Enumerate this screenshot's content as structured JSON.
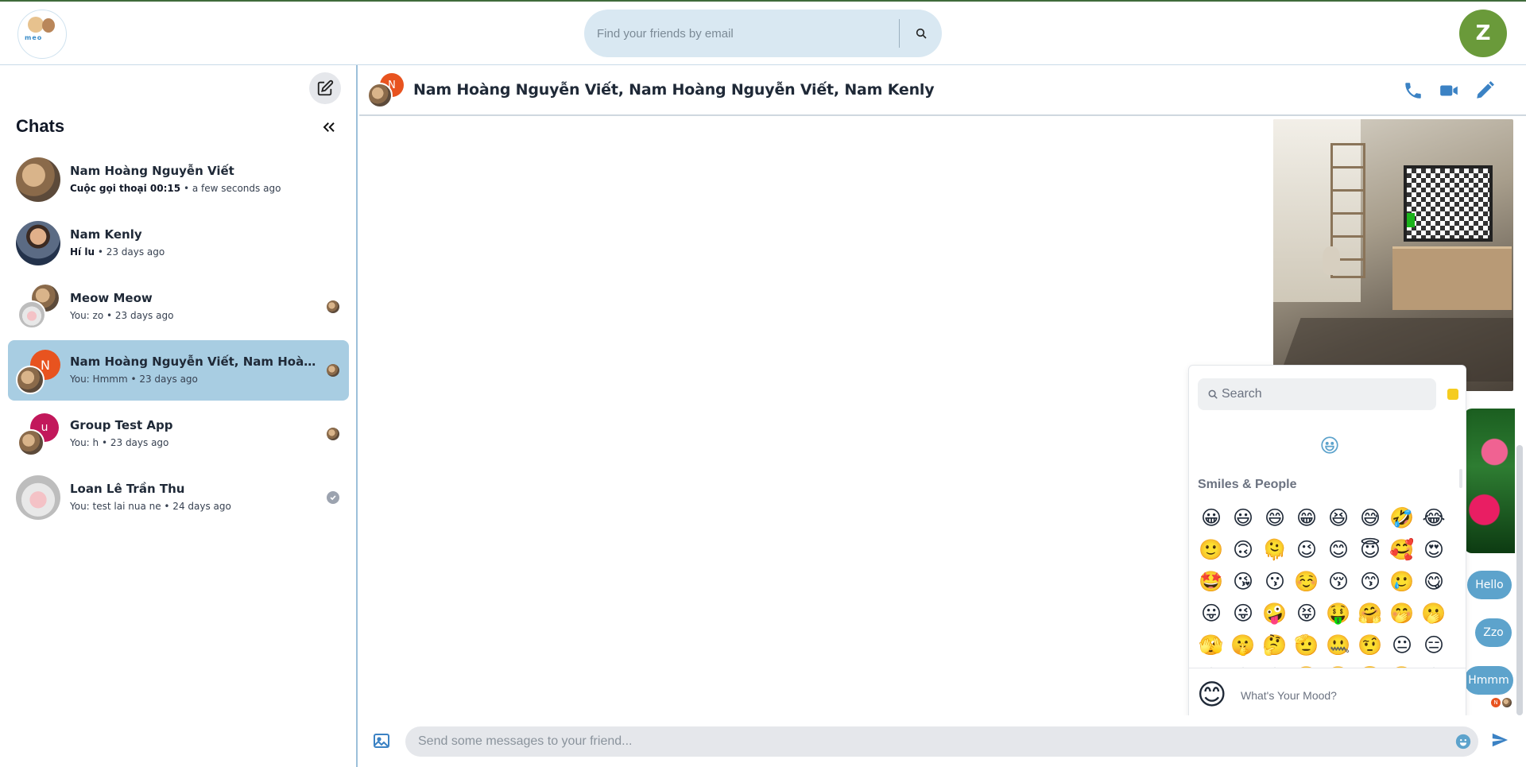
{
  "app": {
    "logo_alt": "Meow app logo",
    "logo_text": "meo",
    "user_initial": "Z"
  },
  "search": {
    "placeholder": "Find your friends by email"
  },
  "sidebar": {
    "title": "Chats",
    "chats": [
      {
        "name": "Nam Hoàng Nguyễn Viết",
        "preview_bold": "Cuộc gọi thoại 00:15",
        "preview_rest": " • a few seconds ago",
        "active": false
      },
      {
        "name": "Nam Kenly",
        "preview_bold": "Hí lu",
        "preview_rest": " • 23 days ago",
        "active": false
      },
      {
        "name": "Meow Meow",
        "preview_bold": "",
        "preview_rest": "You: zo • 23 days ago",
        "active": false
      },
      {
        "name": "Nam Hoàng Nguyễn Viết, Nam Hoàng Nguyễn Viết, Nam Kenly",
        "preview_bold": "",
        "preview_rest": "You: Hmmm • 23 days ago",
        "active": true,
        "initial": "N"
      },
      {
        "name": "Group Test App",
        "preview_bold": "",
        "preview_rest": "You: h • 23 days ago",
        "active": false,
        "initial": "u"
      },
      {
        "name": "Loan Lê Trần Thu",
        "preview_bold": "",
        "preview_rest": "You: test lai nua ne • 24 days ago",
        "active": false
      }
    ]
  },
  "chat": {
    "title": "Nam Hoàng Nguyễn Viết, Nam Hoàng Nguyễn Viết, Nam Kenly",
    "header_initial": "N",
    "messages": [
      {
        "text": "Hello"
      },
      {
        "text": "Zzo"
      },
      {
        "text": "Hmmm"
      }
    ],
    "seen_initial": "N"
  },
  "emoji_picker": {
    "search_placeholder": "Search",
    "category_title": "Smiles & People",
    "category_icon": "😀",
    "emojis": [
      "😀",
      "😃",
      "😄",
      "😁",
      "😆",
      "😅",
      "🤣",
      "😂",
      "🙂",
      "🙃",
      "🫠",
      "😉",
      "😊",
      "😇",
      "🥰",
      "😍",
      "🤩",
      "😘",
      "😗",
      "☺️",
      "😚",
      "😙",
      "🥲",
      "😋",
      "😛",
      "😜",
      "🤪",
      "😝",
      "🤑",
      "🤗",
      "🤭",
      "🫢",
      "🫣",
      "🤫",
      "🤔",
      "🫡",
      "🤐",
      "🤨",
      "😐",
      "😑",
      "😶",
      "😏",
      "😒",
      "🙄",
      "😬",
      "😮‍💨",
      "🤥",
      "😌"
    ],
    "footer_emoji": "😊",
    "footer_placeholder": "What's Your Mood?"
  },
  "composer": {
    "placeholder": "Send some messages to your friend..."
  },
  "colors": {
    "accent": "#5da3cc",
    "active_row": "#a8cde2",
    "avatar_bg": "#6a9a3a",
    "icon_blue": "#3b82c4"
  },
  "icons": {
    "search": "search-icon",
    "compose": "edit-square-icon",
    "collapse": "double-chevron-left-icon",
    "phone": "phone-icon",
    "video": "video-camera-icon",
    "edit": "pencil-icon",
    "image": "image-icon",
    "emoji": "emoji-icon",
    "send": "send-icon",
    "seen_check": "check-circle-icon"
  }
}
